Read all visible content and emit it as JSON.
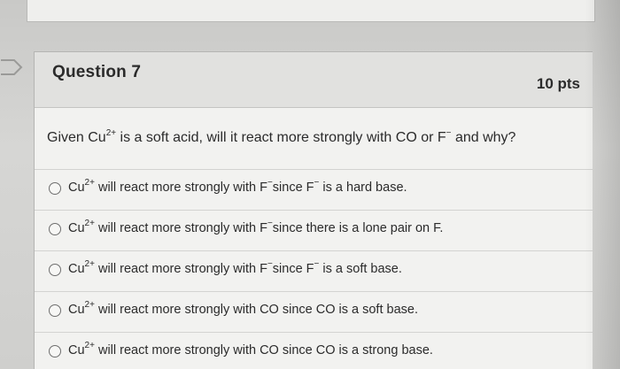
{
  "question": {
    "title": "Question 7",
    "points": "10 pts",
    "prompt": {
      "before": "Given Cu",
      "sup": "2+",
      "middle": " is a soft acid, will it react more strongly with CO or F",
      "sup2": "−",
      "after": " and why?"
    }
  },
  "answers": [
    {
      "pre": "Cu",
      "sup": "2+",
      "mid": " will react more strongly with  F",
      "sup2": "−",
      "mid2": "since  F",
      "sup3": "−",
      "post": " is a hard base."
    },
    {
      "pre": "Cu",
      "sup": "2+",
      "mid": " will react more strongly with  F",
      "sup2": "−",
      "mid2": "since there is a lone pair on F.",
      "sup3": "",
      "post": ""
    },
    {
      "pre": "Cu",
      "sup": "2+",
      "mid": " will react more strongly with  F",
      "sup2": "−",
      "mid2": "since  F",
      "sup3": "−",
      "post": " is a soft base."
    },
    {
      "pre": "Cu",
      "sup": "2+",
      "mid": " will react more strongly with CO since CO is a soft base.",
      "sup2": "",
      "mid2": "",
      "sup3": "",
      "post": ""
    },
    {
      "pre": "Cu",
      "sup": "2+",
      "mid": " will react more strongly with CO since CO is a strong base.",
      "sup2": "",
      "mid2": "",
      "sup3": "",
      "post": ""
    }
  ],
  "icons": {
    "flag": "question-flag-icon",
    "radio": "radio-button-icon"
  },
  "colors": {
    "header": "#e1e1df",
    "card": "#f2f2f0",
    "text": "#2b2b2b"
  }
}
